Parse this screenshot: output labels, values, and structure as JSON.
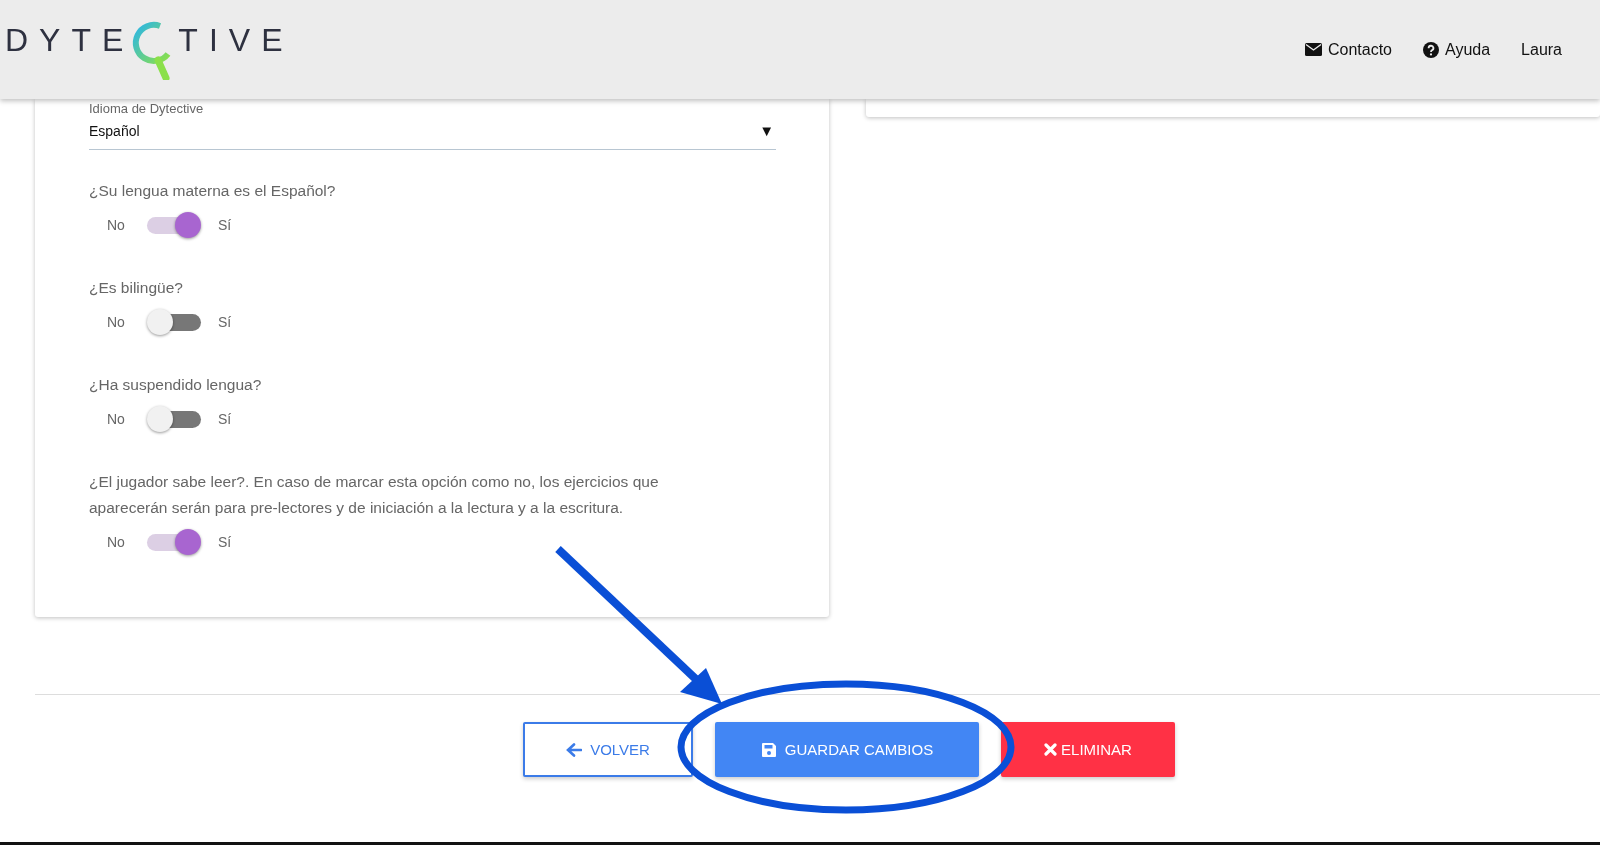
{
  "header": {
    "logo": {
      "left": "DYTE",
      "right": "TIVE"
    },
    "nav": [
      {
        "kind": "mail",
        "label": "Contacto"
      },
      {
        "kind": "help",
        "label": "Ayuda"
      },
      {
        "kind": "user",
        "label": "Laura"
      }
    ]
  },
  "language": {
    "label": "Idioma de Dytective",
    "value": "Español",
    "arrow": "▼"
  },
  "questions": [
    {
      "text": "¿Su lengua materna es el Español?",
      "off_label": "No",
      "on_label": "Sí",
      "on": true
    },
    {
      "text": "¿Es bilingüe?",
      "off_label": "No",
      "on_label": "Sí",
      "on": false
    },
    {
      "text": "¿Ha suspendido lengua?",
      "off_label": "No",
      "on_label": "Sí",
      "on": false
    },
    {
      "text": "¿El jugador sabe leer?. En caso de marcar esta opción como no, los ejercicios que aparecerán serán para pre-lectores y de iniciación a la lectura y a la escritura.",
      "off_label": "No",
      "on_label": "Sí",
      "on": true
    }
  ],
  "buttons": [
    {
      "kind": "back",
      "label": "VOLVER"
    },
    {
      "kind": "save",
      "label": "GUARDAR CAMBIOS"
    },
    {
      "kind": "delete",
      "label": "ELIMINAR"
    }
  ]
}
